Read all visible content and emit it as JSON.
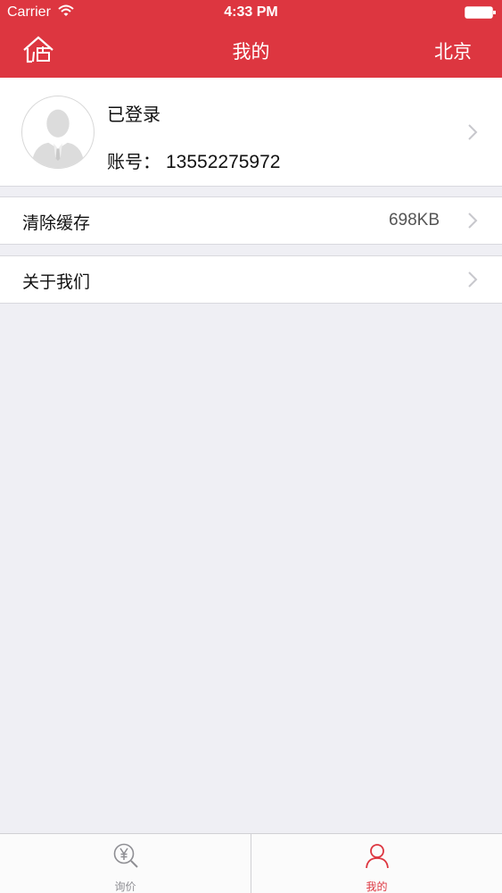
{
  "status_bar": {
    "carrier": "Carrier",
    "time": "4:33 PM"
  },
  "nav": {
    "logo_icon": "house-estimate-logo-icon",
    "title": "我的",
    "city": "北京"
  },
  "profile": {
    "avatar_icon": "default-user-avatar",
    "status": "已登录",
    "account_prefix": "账号：",
    "account_value": "13552275972"
  },
  "settings": {
    "clear_cache": {
      "label": "清除缓存",
      "value": "698KB"
    },
    "about_us": {
      "label": "关于我们"
    }
  },
  "tab_bar": {
    "tabs": [
      {
        "label": "询价",
        "icon": "yuan-search-icon",
        "active": false
      },
      {
        "label": "我的",
        "icon": "person-icon",
        "active": true
      }
    ]
  },
  "colors": {
    "brand_red": "#dd3640",
    "background": "#efeff4",
    "tab_inactive": "#8e8e93"
  }
}
